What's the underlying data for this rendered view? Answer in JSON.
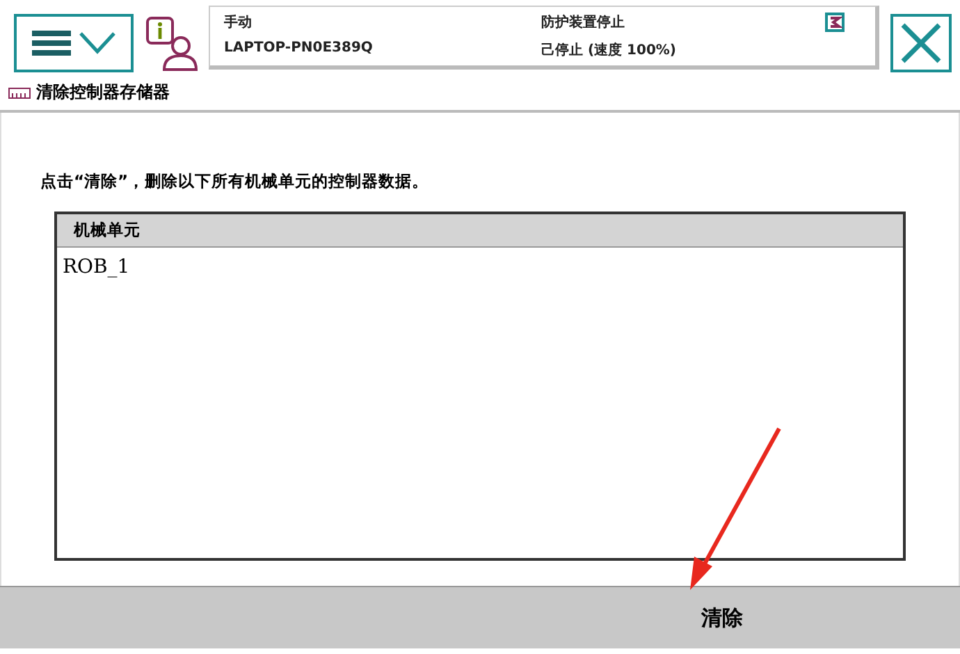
{
  "status_bar": {
    "mode": "手动",
    "controller": "LAPTOP-PN0E389Q",
    "safety": "防护装置停止",
    "state": "己停止 (速度 100%)"
  },
  "title": "清除控制器存储器",
  "instruction": "点击“清除”，删除以下所有机械单元的控制器数据。",
  "table": {
    "column": "机械单元",
    "rows": [
      "ROB_1"
    ]
  },
  "footer_button": "清除"
}
